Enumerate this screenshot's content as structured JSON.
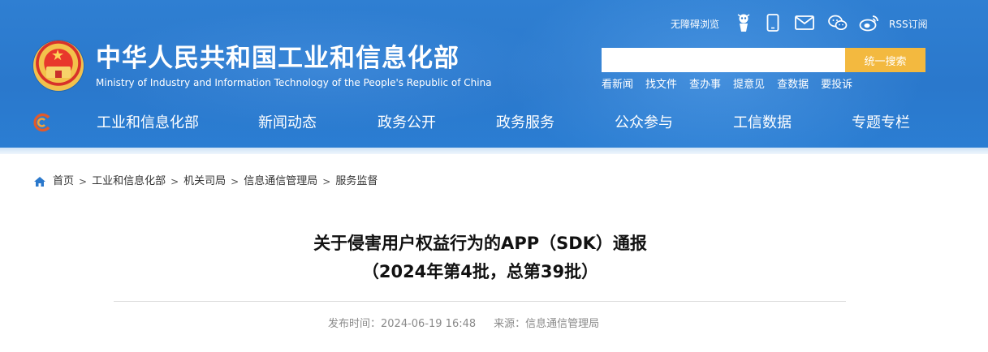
{
  "site": {
    "title": "中华人民共和国工业和信息化部",
    "subtitle": "Ministry of Industry and Information Technology of the People's Republic of China"
  },
  "utility": {
    "accessible_label": "无障碍浏览",
    "rss_label": "RSS订阅",
    "icons": [
      "robot-icon",
      "phone-icon",
      "mail-icon",
      "wechat-icon",
      "weibo-icon"
    ]
  },
  "search": {
    "value": "",
    "placeholder": "",
    "button_label": "统一搜索",
    "quick_links": [
      "看新闻",
      "找文件",
      "查办事",
      "提意见",
      "查数据",
      "要投诉"
    ]
  },
  "nav": {
    "items": [
      "工业和信息化部",
      "新闻动态",
      "政务公开",
      "政务服务",
      "公众参与",
      "工信数据",
      "专题专栏"
    ]
  },
  "breadcrumb": [
    "首页",
    "工业和信息化部",
    "机关司局",
    "信息通信管理局",
    "服务监督"
  ],
  "article": {
    "title_line1": "关于侵害用户权益行为的APP（SDK）通报",
    "title_line2": "（2024年第4批，总第39批）",
    "published": "发布时间：2024-06-19 16:48",
    "source": "来源：信息通信管理局"
  },
  "colors": {
    "banner": "#2a78cc",
    "search_button": "#f3b93f"
  }
}
